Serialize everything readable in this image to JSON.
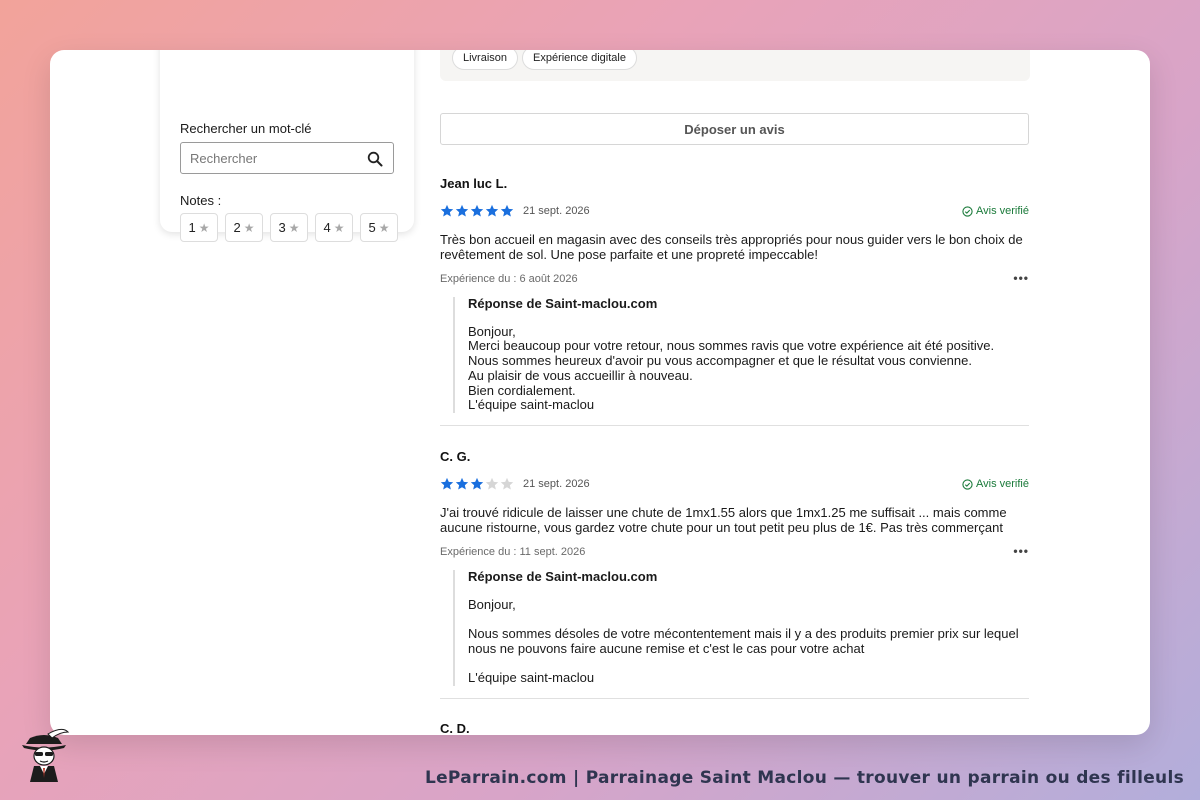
{
  "filters": {
    "search_label": "Rechercher un mot-clé",
    "search_placeholder": "Rechercher",
    "notes_label": "Notes :",
    "ratings": [
      "1",
      "2",
      "3",
      "4",
      "5"
    ]
  },
  "topics": [
    "Livraison",
    "Expérience digitale"
  ],
  "deposit_button": "Déposer un avis",
  "star_color_filled": "#1a6fde",
  "star_color_empty": "#d6d6d6",
  "verified_label": "Avis verifié",
  "more_icon": "ellipsis-icon",
  "reviews": [
    {
      "author": "Jean luc L.",
      "rating": 5,
      "date": "21 sept. 2026",
      "text": "Très bon accueil en magasin avec des conseils très appropriés pour nous guider vers le bon choix de revêtement de sol. Une pose parfaite et une propreté impeccable!",
      "experience": "Expérience du : 6 août 2026",
      "reply": {
        "title": "Réponse de Saint-maclou.com",
        "body": "Bonjour,\nMerci beaucoup pour votre retour, nous sommes ravis que votre expérience ait été positive.\nNous sommes heureux d'avoir pu vous accompagner et que le résultat vous convienne.\nAu plaisir de vous accueillir à nouveau.\nBien cordialement.\nL'équipe saint-maclou"
      }
    },
    {
      "author": "C. G.",
      "rating": 3,
      "date": "21 sept. 2026",
      "text": "J'ai trouvé ridicule de laisser une chute de 1mx1.55 alors que 1mx1.25 me suffisait ... mais comme aucune ristourne, vous gardez votre chute pour un tout petit peu plus de 1€. Pas très commerçant",
      "experience": "Expérience du : 11 sept. 2026",
      "reply": {
        "title": "Réponse de Saint-maclou.com",
        "body": "Bonjour,\n\nNous sommes désoles de votre mécontentement mais il y a des produits premier prix sur  lequel nous ne pouvons faire aucune remise et c'est le cas pour votre achat\n\nL'équipe saint-maclou"
      }
    },
    {
      "author": "C. D."
    }
  ],
  "footer": {
    "text": "LeParrain.com | Parrainage Saint Maclou — trouver un parrain ou des filleuls"
  }
}
